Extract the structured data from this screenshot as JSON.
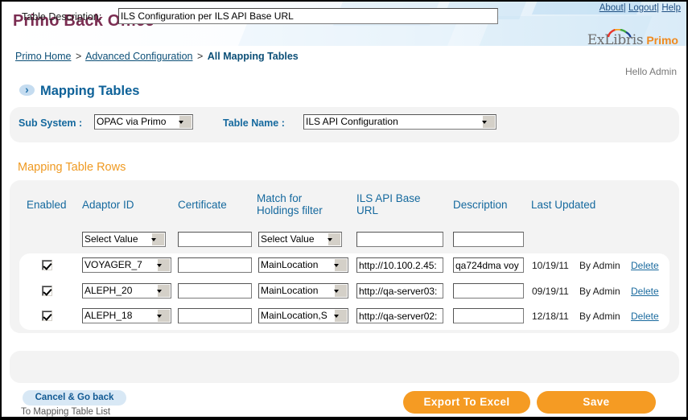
{
  "header": {
    "app_title": "Primo Back Office",
    "top_links": [
      {
        "label": "About",
        "name": "about-link"
      },
      {
        "label": "Logout",
        "name": "logout-link"
      },
      {
        "label": "Help",
        "name": "help-link"
      }
    ],
    "separator": "|",
    "logo": {
      "ex": "ExLibris",
      "product": "Primo"
    },
    "greeting": "Hello Admin"
  },
  "breadcrumb": {
    "items": [
      {
        "label": "Primo Home",
        "link": true
      },
      {
        "label": "Advanced Configuration",
        "link": true
      },
      {
        "label": "All Mapping Tables",
        "link": false
      }
    ],
    "separator": ">"
  },
  "page": {
    "title": "Mapping Tables",
    "arrow_icon": "chevron-right-icon"
  },
  "filter": {
    "sub_system_label": "Sub System :",
    "sub_system_value": "OPAC via Primo",
    "table_name_label": "Table Name :",
    "table_name_value": "ILS API Configuration"
  },
  "grid": {
    "section_title": "Mapping Table Rows",
    "columns": [
      "Enabled",
      "Adaptor ID",
      "Certificate",
      "Match for Holdings filter",
      "ILS API Base URL",
      "Description",
      "Last Updated"
    ],
    "column_lines": {
      "enabled": [
        "Enabled"
      ],
      "adaptor": [
        "Adaptor ID"
      ],
      "certificate": [
        "Certificate"
      ],
      "match": [
        "Match for",
        "Holdings filter"
      ],
      "ils_url": [
        "ILS API Base",
        "URL"
      ],
      "description": [
        "Description"
      ],
      "last_updated": [
        "Last Updated"
      ]
    },
    "new_row": {
      "adaptor_id": "Select Value",
      "certificate": "",
      "match_holdings": "Select Value",
      "ils_api_base_url": "",
      "description": ""
    },
    "rows": [
      {
        "enabled": true,
        "adaptor_id": "VOYAGER_7",
        "certificate": "",
        "match_holdings": "MainLocation",
        "ils_api_base_url": "http://10.100.2.45:",
        "description": "qa724dma voy",
        "last_updated_date": "10/19/11",
        "last_updated_by": "By Admin",
        "delete_label": "Delete"
      },
      {
        "enabled": true,
        "adaptor_id": "ALEPH_20",
        "certificate": "",
        "match_holdings": "MainLocation",
        "ils_api_base_url": "http://qa-server03:",
        "description": "",
        "last_updated_date": "09/19/11",
        "last_updated_by": "By Admin",
        "delete_label": "Delete"
      },
      {
        "enabled": true,
        "adaptor_id": "ALEPH_18",
        "certificate": "",
        "match_holdings": "MainLocation,S",
        "ils_api_base_url": "http://qa-server02:",
        "description": "",
        "last_updated_date": "12/18/11",
        "last_updated_by": "By Admin",
        "delete_label": "Delete"
      }
    ]
  },
  "description_area": {
    "label": "Table Description:",
    "value": "ILS Configuration per ILS API Base URL"
  },
  "footer": {
    "cancel_label": "Cancel & Go back",
    "cancel_sub_label": "To Mapping Table List",
    "export_label": "Export To Excel",
    "save_label": "Save"
  },
  "colors": {
    "brand_maroon": "#7b2d52",
    "accent_blue": "#15699e",
    "accent_orange": "#ef9a22",
    "button_orange": "#f59b23",
    "link_blue": "#1f4f82",
    "panel_gray": "#f3f3f3"
  }
}
